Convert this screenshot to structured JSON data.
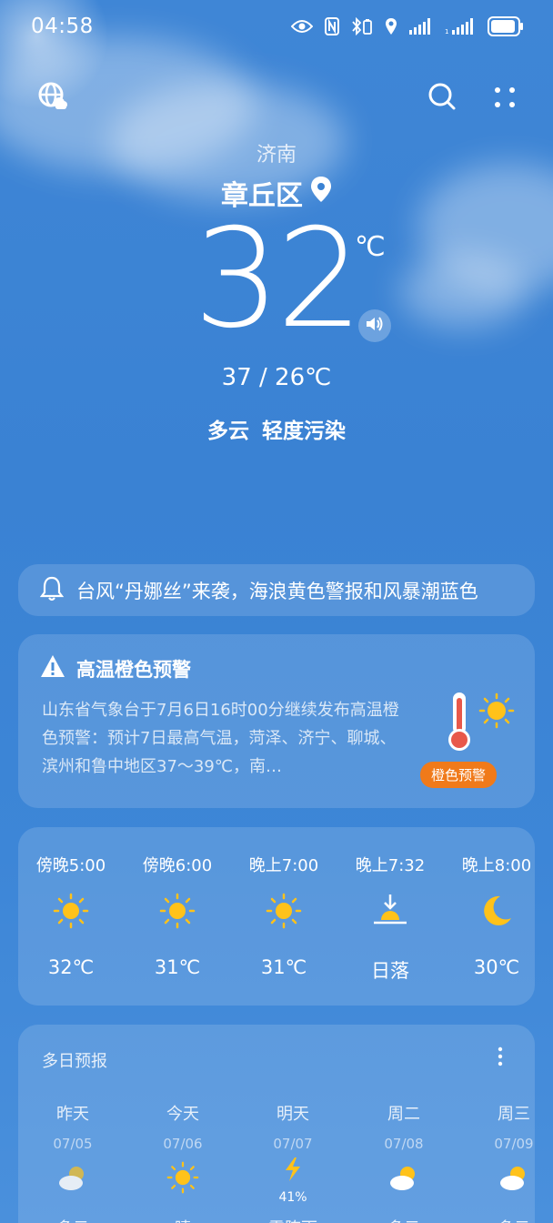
{
  "status_bar": {
    "time": "04:58",
    "icons": [
      "eye-icon",
      "nfc-icon",
      "bluetooth-battery-icon",
      "location-icon",
      "signal-icon",
      "signal-4g-icon",
      "battery-icon"
    ]
  },
  "top_bar": {
    "left_icon": "globe-cloud-icon",
    "search_icon": "search-icon",
    "menu_icon": "four-dot-menu-icon"
  },
  "location": {
    "city": "济南",
    "district": "章丘区"
  },
  "current": {
    "temperature": "32",
    "unit": "℃",
    "range": "37 / 26℃",
    "condition": "多云",
    "air_quality": "轻度污染"
  },
  "ticker": {
    "text": "台风“丹娜丝”来袭，海浪黄色警报和风暴潮蓝色"
  },
  "warning": {
    "title": "高温橙色预警",
    "body": "山东省气象台于7月6日16时00分继续发布高温橙色预警：预计7日最高气温，菏泽、济宁、聊城、滨州和鲁中地区37～39℃，南…",
    "badge": "橙色预警",
    "colors": {
      "badge": "#f07a1a"
    }
  },
  "hourly": [
    {
      "time": "傍晚5:00",
      "icon": "sun-icon",
      "temp": "32℃"
    },
    {
      "time": "傍晚6:00",
      "icon": "sun-icon",
      "temp": "31℃"
    },
    {
      "time": "晚上7:00",
      "icon": "sun-icon",
      "temp": "31℃"
    },
    {
      "time": "晚上7:32",
      "icon": "sunset-icon",
      "temp": "日落"
    },
    {
      "time": "晚上8:00",
      "icon": "moon-icon",
      "temp": "30℃"
    }
  ],
  "daily": {
    "title": "多日预报",
    "days": [
      {
        "name": "昨天",
        "date": "07/05",
        "icon": "partly-cloudy-icon",
        "precip": "",
        "cond": "多云"
      },
      {
        "name": "今天",
        "date": "07/06",
        "icon": "sun-icon",
        "precip": "",
        "cond": "晴"
      },
      {
        "name": "明天",
        "date": "07/07",
        "icon": "thunder-icon",
        "precip": "41%",
        "cond": "雷阵雨"
      },
      {
        "name": "周二",
        "date": "07/08",
        "icon": "partly-cloudy-icon",
        "precip": "",
        "cond": "多云"
      },
      {
        "name": "周三",
        "date": "07/09",
        "icon": "partly-cloudy-icon",
        "precip": "",
        "cond": "多云"
      }
    ]
  }
}
